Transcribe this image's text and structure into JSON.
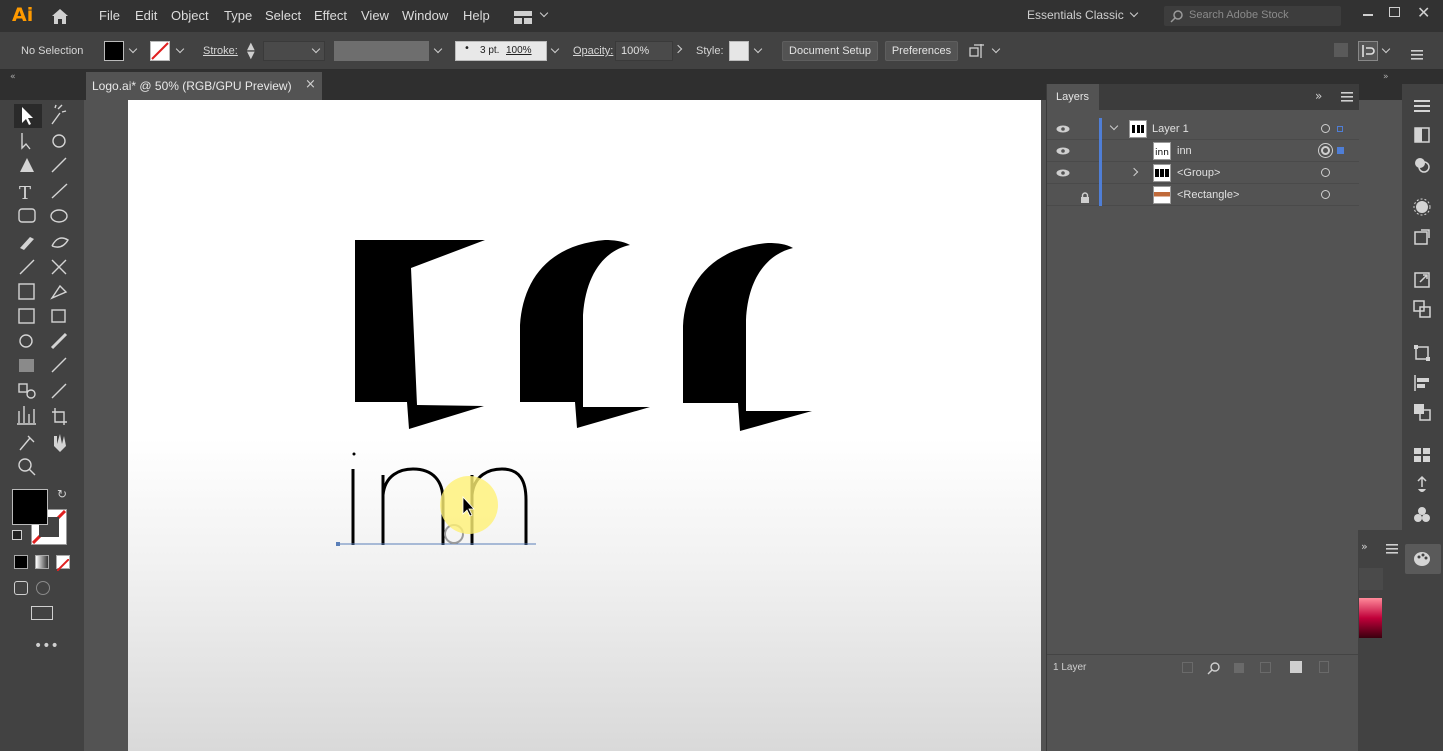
{
  "app": {
    "logo": "Ai",
    "menu": [
      "File",
      "Edit",
      "Object",
      "Type",
      "Select",
      "Effect",
      "View",
      "Window",
      "Help"
    ],
    "workspace": "Essentials Classic",
    "stock_search_placeholder": "Search Adobe Stock"
  },
  "control_bar": {
    "selection": "No Selection",
    "stroke_label": "Stroke:",
    "stroke_weight": "3 pt.",
    "stroke_percent": "100%",
    "opacity_label": "Opacity:",
    "opacity_value": "100%",
    "style_label": "Style:",
    "document_setup": "Document Setup",
    "preferences": "Preferences"
  },
  "document": {
    "tab_title": "Logo.ai* @ 50% (RGB/GPU Preview)",
    "close": "×",
    "art_text": "inn"
  },
  "layers_panel": {
    "title": "Layers",
    "rows": [
      {
        "name": "Layer 1",
        "visible": true,
        "expanded": true
      },
      {
        "name": "inn",
        "visible": true
      },
      {
        "name": "<Group>",
        "visible": true,
        "expandable": true
      },
      {
        "name": "<Rectangle>",
        "visible": false,
        "locked": true
      }
    ],
    "count": "1 Layer"
  },
  "colors": {
    "ai_orange": "#ff9a00",
    "layer_blue": "#4f7ed6",
    "fill": "#000000",
    "cursor_highlight": "#fff176"
  }
}
